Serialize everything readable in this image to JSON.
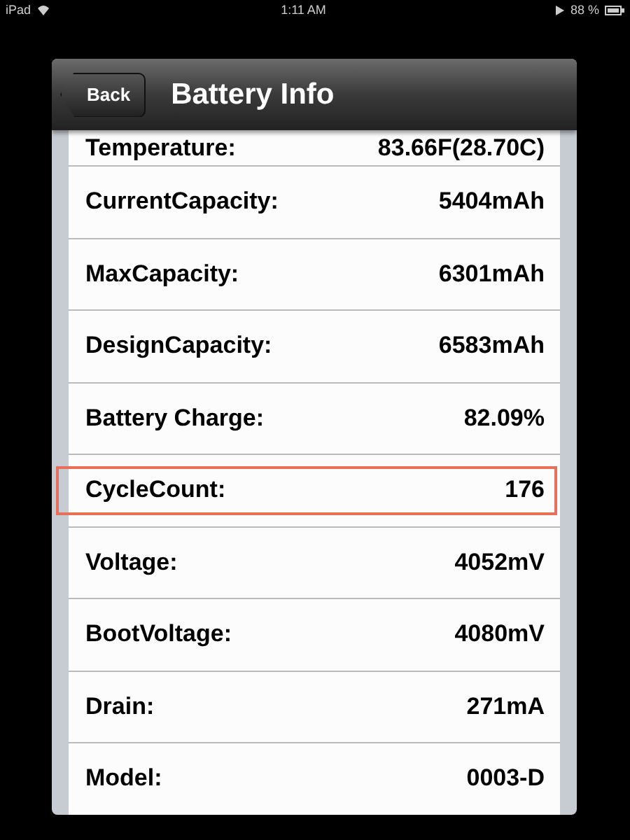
{
  "status_bar": {
    "device": "iPad",
    "time": "1:11 AM",
    "battery": "88 %"
  },
  "nav_bar": {
    "back": "Back",
    "title": "Battery Info"
  },
  "rows": [
    {
      "label": "Temperature:",
      "value": "83.66F(28.70C)",
      "highlighted": false
    },
    {
      "label": "CurrentCapacity:",
      "value": "5404mAh",
      "highlighted": false
    },
    {
      "label": "MaxCapacity:",
      "value": "6301mAh",
      "highlighted": false
    },
    {
      "label": "DesignCapacity:",
      "value": "6583mAh",
      "highlighted": false
    },
    {
      "label": "Battery Charge:",
      "value": "82.09%",
      "highlighted": false
    },
    {
      "label": "CycleCount:",
      "value": "176",
      "highlighted": true
    },
    {
      "label": "Voltage:",
      "value": "4052mV",
      "highlighted": false
    },
    {
      "label": "BootVoltage:",
      "value": "4080mV",
      "highlighted": false
    },
    {
      "label": "Drain:",
      "value": "271mA",
      "highlighted": false
    },
    {
      "label": "Model:",
      "value": "0003-D",
      "highlighted": false
    }
  ]
}
